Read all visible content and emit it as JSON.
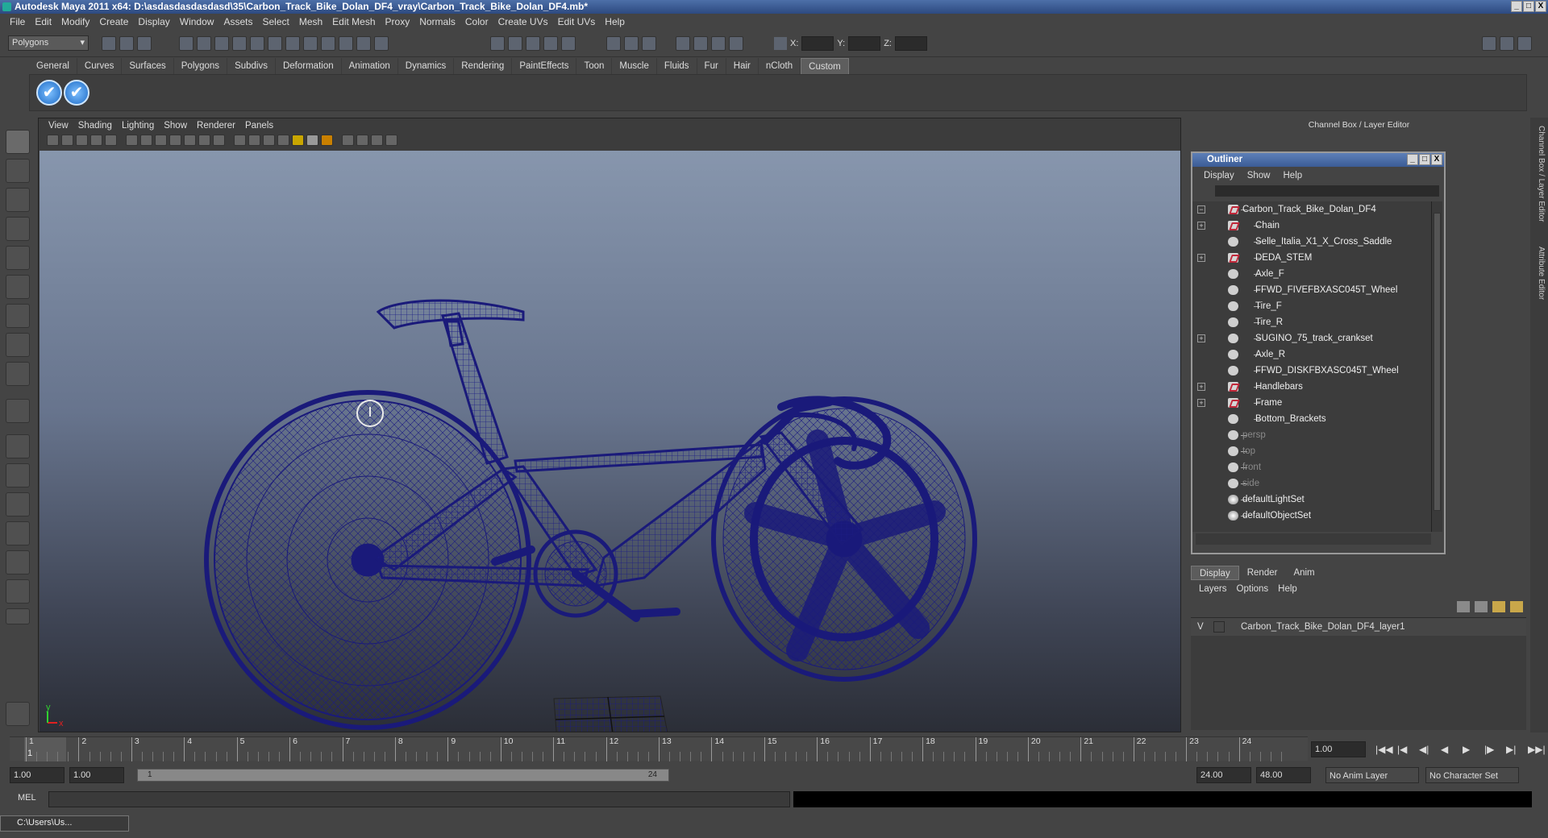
{
  "window": {
    "title": "Autodesk Maya 2011 x64: D:\\asdasdasdasdasd\\35\\Carbon_Track_Bike_Dolan_DF4_vray\\Carbon_Track_Bike_Dolan_DF4.mb*",
    "controls": [
      "_",
      "□",
      "X"
    ]
  },
  "menubar": [
    "File",
    "Edit",
    "Modify",
    "Create",
    "Display",
    "Window",
    "Assets",
    "Select",
    "Mesh",
    "Edit Mesh",
    "Proxy",
    "Normals",
    "Color",
    "Create UVs",
    "Edit UVs",
    "Help"
  ],
  "statusline": {
    "mode": "Polygons",
    "x_label": "X:",
    "y_label": "Y:",
    "z_label": "Z:"
  },
  "shelf": {
    "tabs": [
      "General",
      "Curves",
      "Surfaces",
      "Polygons",
      "Subdivs",
      "Deformation",
      "Animation",
      "Dynamics",
      "Rendering",
      "PaintEffects",
      "Toon",
      "Muscle",
      "Fluids",
      "Fur",
      "Hair",
      "nCloth",
      "Custom"
    ],
    "active_tab": "Custom",
    "check_glyph": "✔"
  },
  "viewport": {
    "menu": [
      "View",
      "Shading",
      "Lighting",
      "Show",
      "Renderer",
      "Panels"
    ],
    "wire_color": "#1a1a7a",
    "axis": {
      "x": "x",
      "y": "y"
    }
  },
  "channel_box": {
    "header": "Channel Box / Layer Editor",
    "side_tabs": [
      "Channel Box / Layer Editor",
      "Attribute Editor"
    ]
  },
  "outliner": {
    "title": "Outliner",
    "menu": [
      "Display",
      "Show",
      "Help"
    ],
    "items": [
      {
        "label": "Carbon_Track_Bike_Dolan_DF4",
        "depth": 0,
        "expand": "−",
        "icon": "transform-icon",
        "dim": false
      },
      {
        "label": "Chain",
        "depth": 1,
        "expand": "+",
        "icon": "transform-icon",
        "dim": false
      },
      {
        "label": "Selle_Italia_X1_X_Cross_Saddle",
        "depth": 1,
        "expand": "",
        "icon": "mesh-icon",
        "dim": false
      },
      {
        "label": "DEDA_STEM",
        "depth": 1,
        "expand": "+",
        "icon": "transform-icon",
        "dim": false
      },
      {
        "label": "Axle_F",
        "depth": 1,
        "expand": "",
        "icon": "mesh-icon",
        "dim": false
      },
      {
        "label": "FFWD_FIVEFBXASC045T_Wheel",
        "depth": 1,
        "expand": "",
        "icon": "mesh-icon",
        "dim": false
      },
      {
        "label": "Tire_F",
        "depth": 1,
        "expand": "",
        "icon": "mesh-icon",
        "dim": false
      },
      {
        "label": "Tire_R",
        "depth": 1,
        "expand": "",
        "icon": "mesh-icon",
        "dim": false
      },
      {
        "label": "SUGINO_75_track_crankset",
        "depth": 1,
        "expand": "+",
        "icon": "mesh-icon",
        "dim": false
      },
      {
        "label": "Axle_R",
        "depth": 1,
        "expand": "",
        "icon": "mesh-icon",
        "dim": false
      },
      {
        "label": "FFWD_DISKFBXASC045T_Wheel",
        "depth": 1,
        "expand": "",
        "icon": "mesh-icon",
        "dim": false
      },
      {
        "label": "Handlebars",
        "depth": 1,
        "expand": "+",
        "icon": "transform-icon",
        "dim": false
      },
      {
        "label": "Frame",
        "depth": 1,
        "expand": "+",
        "icon": "transform-icon",
        "dim": false
      },
      {
        "label": "Bottom_Brackets",
        "depth": 1,
        "expand": "",
        "icon": "mesh-icon",
        "dim": false
      },
      {
        "label": "persp",
        "depth": 0,
        "expand": "",
        "icon": "camera-icon",
        "dim": true
      },
      {
        "label": "top",
        "depth": 0,
        "expand": "",
        "icon": "camera-icon",
        "dim": true
      },
      {
        "label": "front",
        "depth": 0,
        "expand": "",
        "icon": "camera-icon",
        "dim": true
      },
      {
        "label": "side",
        "depth": 0,
        "expand": "",
        "icon": "camera-icon",
        "dim": true
      },
      {
        "label": "defaultLightSet",
        "depth": 0,
        "expand": "",
        "icon": "set-icon",
        "dim": false
      },
      {
        "label": "defaultObjectSet",
        "depth": 0,
        "expand": "",
        "icon": "set-icon",
        "dim": false
      }
    ]
  },
  "layer_editor": {
    "tabs": [
      "Display",
      "Render",
      "Anim"
    ],
    "active_tab": "Display",
    "menu": [
      "Layers",
      "Options",
      "Help"
    ],
    "layers": [
      {
        "visible": "V",
        "name": "Carbon_Track_Bike_Dolan_DF4_layer1"
      }
    ]
  },
  "timeline": {
    "ticks": [
      "1",
      "2",
      "3",
      "4",
      "5",
      "6",
      "7",
      "8",
      "9",
      "10",
      "11",
      "12",
      "13",
      "14",
      "15",
      "16",
      "17",
      "18",
      "19",
      "20",
      "21",
      "22",
      "23",
      "24"
    ],
    "current_frame_marker": "1",
    "current_time": "1.00",
    "playback_glyphs": [
      "|◀◀",
      "|◀",
      "◀|",
      "◀",
      "▶",
      "|▶",
      "▶|",
      "▶▶|"
    ]
  },
  "range": {
    "start": "1.00",
    "playback_start": "1.00",
    "slider_start": "1",
    "slider_end": "24",
    "playback_end": "24.00",
    "end": "48.00",
    "anim_layer": "No Anim Layer",
    "character_set": "No Character Set"
  },
  "command_line": {
    "label": "MEL"
  },
  "taskbar": {
    "label": "C:\\Users\\Us..."
  }
}
